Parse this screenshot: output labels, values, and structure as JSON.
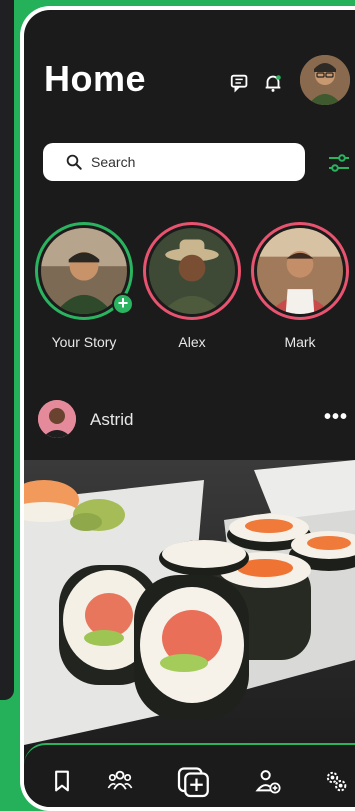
{
  "header": {
    "title": "Home",
    "icons": [
      "chat-icon",
      "bell-icon"
    ]
  },
  "search": {
    "placeholder": "Search"
  },
  "stories": [
    {
      "name": "Your Story",
      "own": true
    },
    {
      "name": "Alex",
      "own": false
    },
    {
      "name": "Mark",
      "own": false
    }
  ],
  "post": {
    "user": "Astrid",
    "more": "•••"
  },
  "bottom_nav": {
    "icons": [
      "bookmark-icon",
      "group-icon",
      "add-post-icon",
      "add-friend-icon",
      "settings-icon"
    ]
  },
  "colors": {
    "accent": "#2bb45f",
    "story_ring": "#e8536f",
    "background": "#1b1b1c"
  }
}
